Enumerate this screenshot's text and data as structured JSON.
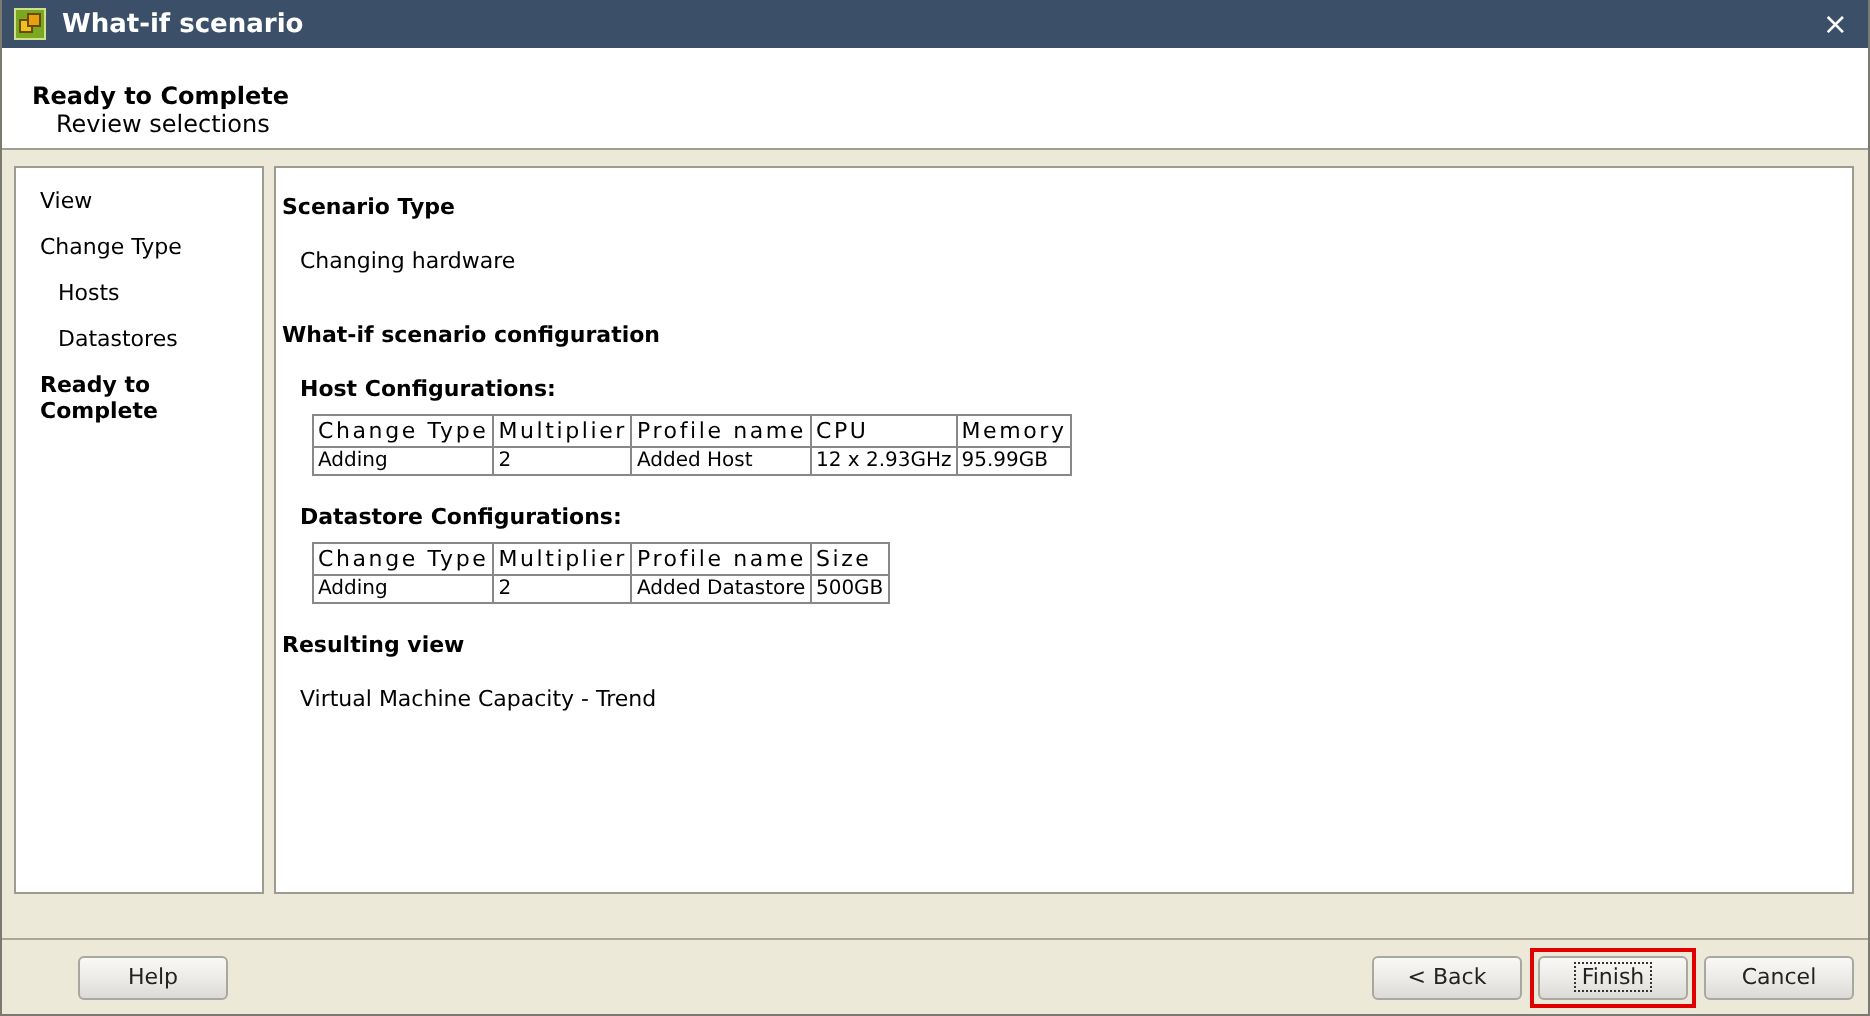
{
  "window": {
    "title": "What-if scenario",
    "close": "×"
  },
  "header": {
    "title": "Ready to Complete",
    "subtitle": "Review selections"
  },
  "nav": [
    {
      "label": "View",
      "selected": false
    },
    {
      "label": "Change Type",
      "selected": false,
      "children": [
        {
          "label": "Hosts",
          "selected": false
        },
        {
          "label": "Datastores",
          "selected": false
        }
      ]
    },
    {
      "label": "Ready to Complete",
      "selected": true
    }
  ],
  "content": [
    {
      "kind": "heading",
      "text": "Scenario Type"
    },
    {
      "kind": "text",
      "text": "Changing hardware"
    },
    {
      "kind": "heading",
      "text": "What-if scenario configuration"
    },
    {
      "kind": "subheading",
      "text": "Host Configurations:"
    },
    {
      "kind": "table",
      "columns": [
        "Change Type",
        "Multiplier",
        "Profile name",
        "CPU",
        "Memory"
      ],
      "rows": [
        [
          "Adding",
          "2",
          "Added Host",
          "12 x 2.93GHz",
          "95.99GB"
        ]
      ]
    },
    {
      "kind": "subheading",
      "text": "Datastore Configurations:"
    },
    {
      "kind": "table",
      "columns": [
        "Change Type",
        "Multiplier",
        "Profile name",
        "Size"
      ],
      "rows": [
        [
          "Adding",
          "2",
          "Added Datastore",
          "500GB"
        ]
      ]
    },
    {
      "kind": "heading",
      "text": "Resulting view"
    },
    {
      "kind": "text",
      "text": "Virtual Machine Capacity - Trend"
    }
  ],
  "buttons": [
    {
      "label": "Help",
      "kind": "help",
      "focused": false,
      "highlighted": false
    },
    {
      "label": "< Back",
      "kind": "wizard",
      "focused": false,
      "highlighted": false
    },
    {
      "label": "Finish",
      "kind": "wizard",
      "focused": true,
      "highlighted": true
    },
    {
      "label": "Cancel",
      "kind": "wizard",
      "focused": false,
      "highlighted": false
    }
  ]
}
